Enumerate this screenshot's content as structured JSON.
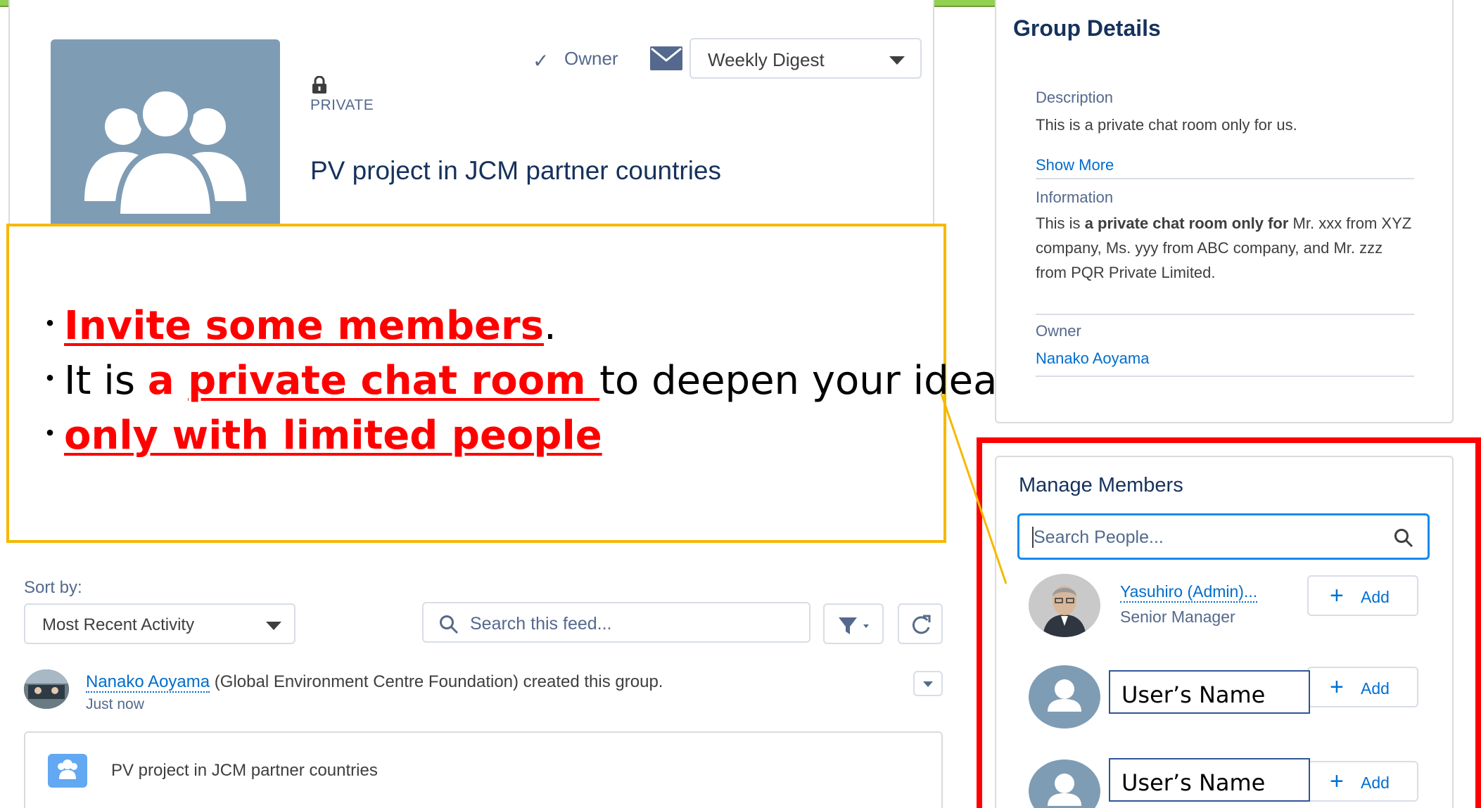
{
  "group": {
    "privacy": "PRIVATE",
    "name": "PV project in JCM partner countries",
    "owner_label": "Owner",
    "digest": "Weekly Digest"
  },
  "callout": {
    "line1_a": "Invite some members",
    "line1_b": ".",
    "line2_a": "It is ",
    "line2_b": "a ",
    "line2_c": "private chat room ",
    "line2_d": "to deepen your idea",
    "line3": "only with limited people",
    "bullet": "・"
  },
  "feed": {
    "sort_label": "Sort by:",
    "sort_value": "Most Recent Activity",
    "search_placeholder": "Search this feed...",
    "post_author": "Nanako Aoyama",
    "post_text": " (Global Environment Centre Foundation) created this group.",
    "post_time": "Just now",
    "post_group": "PV project in JCM partner countries"
  },
  "details": {
    "title": "Group Details",
    "description_label": "Description",
    "description": "This is a private chat room only for us.",
    "show_more": "Show More",
    "information_label": "Information",
    "info_pre": "This is ",
    "info_bold": "a private chat room only for",
    "info_post": " Mr. xxx from XYZ company, Ms. yyy from ABC company, and Mr. zzz from PQR Private Limited.",
    "owner_label": "Owner",
    "owner_name": "Nanako Aoyama"
  },
  "members": {
    "title": "Manage Members",
    "search_placeholder": "Search People...",
    "add_label": "Add",
    "list": [
      {
        "name": "Yasuhiro (Admin)...",
        "title": "Senior Manager"
      },
      {
        "name": "User’s Name"
      },
      {
        "name": "User’s Name"
      }
    ]
  },
  "colors": {
    "accent_red": "#ff0000",
    "callout_border": "#f5b800",
    "link_blue": "#006dcc",
    "top_bar": "#92d050"
  }
}
